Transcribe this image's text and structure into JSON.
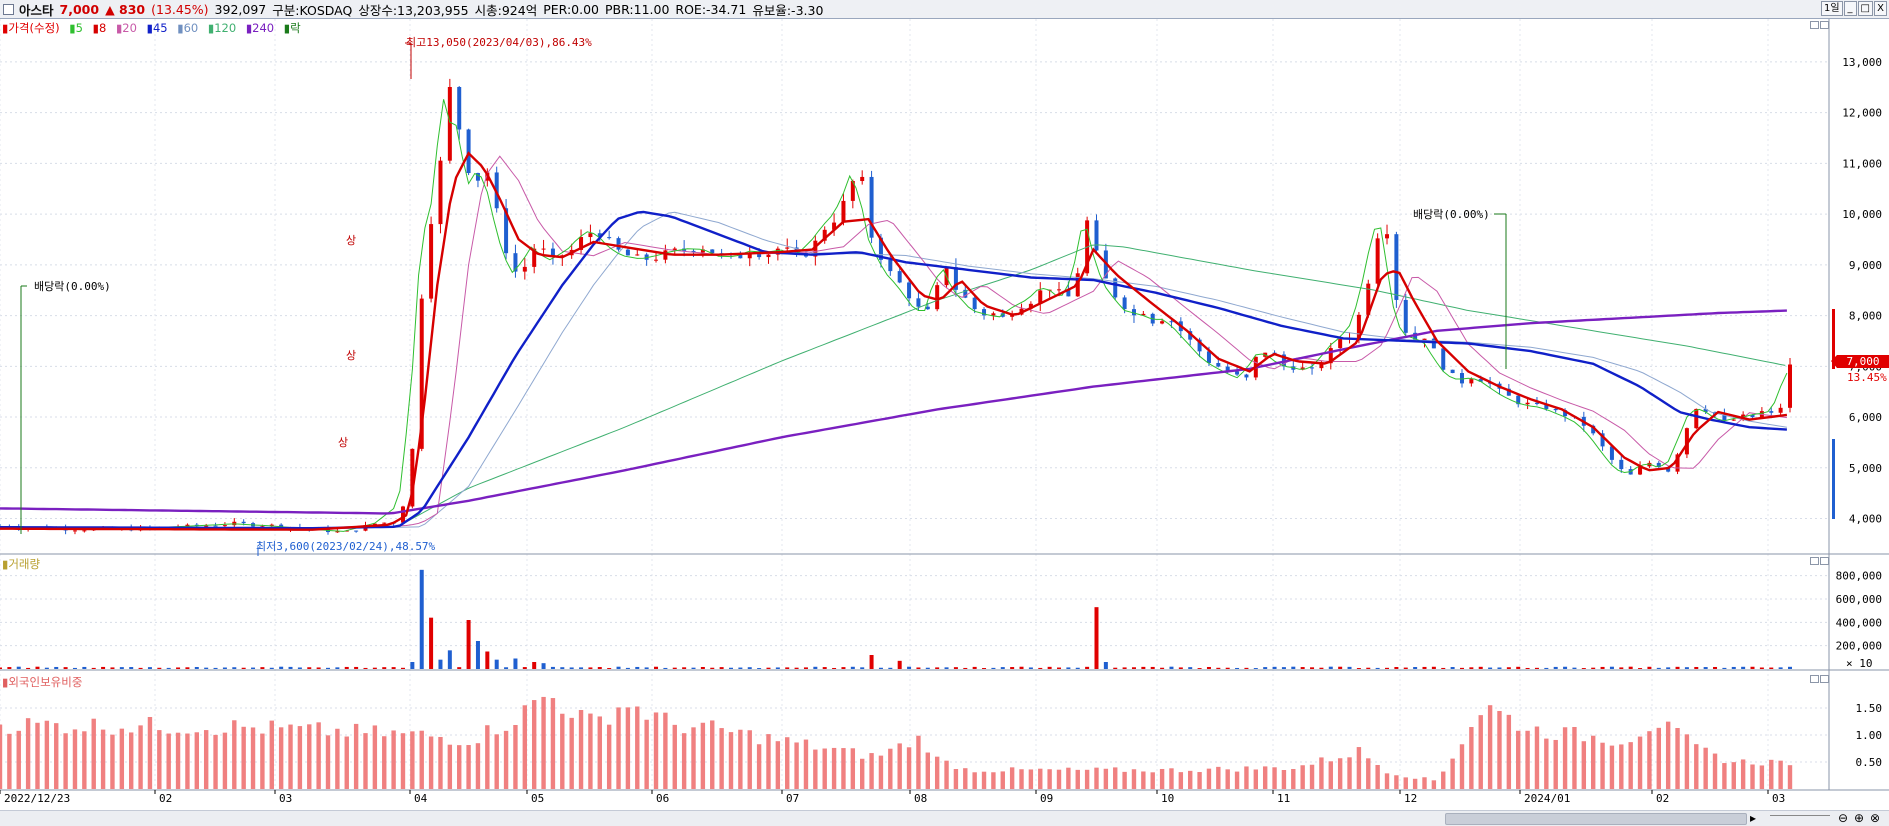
{
  "title_bar": {
    "stock_name": "아스타",
    "price": "7,000",
    "change": "▲ 830",
    "change_pct": "(13.45%)",
    "volume": "392,097",
    "market": "구분:KOSDAQ",
    "shares": "상장수:13,203,955",
    "market_cap": "시총:924억",
    "per": "PER:0.00",
    "pbr": "PBR:11.00",
    "roe": "ROE:-34.71",
    "float_ratio": "유보율:-3.30",
    "period_button": "1일",
    "minimize": "_",
    "maximize": "□",
    "close": "X"
  },
  "legend": {
    "price": "가격(수정)",
    "ma5": "5",
    "ma8": "8",
    "ma20": "20",
    "ma45": "45",
    "ma60": "60",
    "ma120": "120",
    "ma240": "240",
    "exdiv": "락"
  },
  "colors": {
    "up": "#e00000",
    "down": "#1f5fd0",
    "ma5": "#2fbf2f",
    "ma8": "#d60000",
    "ma20": "#c85aa8",
    "ma45": "#1020c8",
    "ma60": "#7090c0",
    "ma120": "#40b070",
    "ma240": "#7a20c0",
    "foreign": "#f08080"
  },
  "annotations": {
    "high": "최고13,050(2023/04/03),86.43%",
    "low": "최저3,600(2023/02/24),48.57%",
    "exdiv_left": "배당락(0.00%)",
    "exdiv_right": "배당락(0.00%)",
    "limit_up_1": "상",
    "limit_up_2": "상",
    "limit_up_3": "상"
  },
  "current_price_tag": {
    "price": "7,000",
    "pct": "13.45%"
  },
  "panes": {
    "volume_title": "거래량",
    "foreign_title": "외국인보유비중",
    "volume_multiplier": "× 10"
  },
  "chart_data": [
    {
      "type": "candlestick",
      "name": "price",
      "y_ticks": [
        "13,000",
        "12,000",
        "11,000",
        "10,000",
        "9,000",
        "8,000",
        "7,000",
        "6,000",
        "5,000",
        "4,000"
      ],
      "y_tick_values": [
        13000,
        12000,
        11000,
        10000,
        9000,
        8000,
        7000,
        6000,
        5000,
        4000
      ],
      "ylim": [
        3400,
        13450
      ],
      "x_ticks": [
        "2022/12/23",
        "02",
        "03",
        "04",
        "05",
        "06",
        "07",
        "08",
        "09",
        "10",
        "11",
        "12",
        "2024/01",
        "02",
        "03"
      ],
      "close_path": [
        [
          0,
          3850
        ],
        [
          40,
          3800
        ],
        [
          70,
          3780
        ],
        [
          100,
          3820
        ],
        [
          125,
          3850
        ],
        [
          150,
          3900
        ],
        [
          175,
          3860
        ],
        [
          200,
          3800
        ],
        [
          220,
          3720
        ],
        [
          240,
          3900
        ],
        [
          255,
          3950
        ],
        [
          263,
          4800
        ],
        [
          268,
          7600
        ],
        [
          272,
          9200
        ],
        [
          276,
          9900
        ],
        [
          280,
          10300
        ],
        [
          284,
          11700
        ],
        [
          288,
          12450
        ],
        [
          292,
          11600
        ],
        [
          296,
          11800
        ],
        [
          300,
          10900
        ],
        [
          304,
          10500
        ],
        [
          310,
          11100
        ],
        [
          316,
          10300
        ],
        [
          322,
          9500
        ],
        [
          328,
          8900
        ],
        [
          334,
          8800
        ],
        [
          340,
          9300
        ],
        [
          346,
          9400
        ],
        [
          352,
          9000
        ],
        [
          358,
          9200
        ],
        [
          364,
          9200
        ],
        [
          370,
          9450
        ],
        [
          376,
          9600
        ],
        [
          382,
          9700
        ],
        [
          388,
          9500
        ],
        [
          394,
          9300
        ],
        [
          400,
          9200
        ],
        [
          410,
          9100
        ],
        [
          420,
          9150
        ],
        [
          430,
          9250
        ],
        [
          440,
          9300
        ],
        [
          450,
          9350
        ],
        [
          460,
          9200
        ],
        [
          470,
          9100
        ],
        [
          480,
          9300
        ],
        [
          490,
          9200
        ],
        [
          500,
          9350
        ],
        [
          510,
          9150
        ],
        [
          520,
          9300
        ],
        [
          526,
          9700
        ],
        [
          532,
          9800
        ],
        [
          538,
          10100
        ],
        [
          544,
          10400
        ],
        [
          550,
          11100
        ],
        [
          556,
          9700
        ],
        [
          562,
          9300
        ],
        [
          568,
          8900
        ],
        [
          574,
          8700
        ],
        [
          580,
          8500
        ],
        [
          586,
          8200
        ],
        [
          592,
          8000
        ],
        [
          598,
          8200
        ],
        [
          604,
          9200
        ],
        [
          610,
          8600
        ],
        [
          616,
          8400
        ],
        [
          622,
          8200
        ],
        [
          628,
          8000
        ],
        [
          634,
          8100
        ],
        [
          640,
          7900
        ],
        [
          646,
          8050
        ],
        [
          652,
          8200
        ],
        [
          658,
          8250
        ],
        [
          664,
          8400
        ],
        [
          670,
          8600
        ],
        [
          676,
          8500
        ],
        [
          682,
          8300
        ],
        [
          688,
          8500
        ],
        [
          694,
          9600
        ],
        [
          698,
          10100
        ],
        [
          702,
          9200
        ],
        [
          708,
          8700
        ],
        [
          714,
          8400
        ],
        [
          720,
          8200
        ],
        [
          726,
          8000
        ],
        [
          732,
          8100
        ],
        [
          738,
          7900
        ],
        [
          744,
          7950
        ],
        [
          750,
          7900
        ],
        [
          756,
          7700
        ],
        [
          762,
          7500
        ],
        [
          768,
          7300
        ],
        [
          774,
          7100
        ],
        [
          780,
          7000
        ],
        [
          786,
          6900
        ],
        [
          792,
          6800
        ],
        [
          798,
          6750
        ],
        [
          804,
          7150
        ],
        [
          810,
          7300
        ],
        [
          816,
          7200
        ],
        [
          822,
          7000
        ],
        [
          828,
          7000
        ],
        [
          834,
          6950
        ],
        [
          840,
          6900
        ],
        [
          846,
          7100
        ],
        [
          852,
          7300
        ],
        [
          858,
          7550
        ],
        [
          864,
          7600
        ],
        [
          870,
          8000
        ],
        [
          876,
          8700
        ],
        [
          880,
          9400
        ],
        [
          884,
          9800
        ],
        [
          888,
          9700
        ],
        [
          892,
          8700
        ],
        [
          896,
          8000
        ],
        [
          900,
          7700
        ],
        [
          906,
          7500
        ],
        [
          912,
          7600
        ],
        [
          918,
          7300
        ],
        [
          924,
          7000
        ],
        [
          930,
          6800
        ],
        [
          936,
          6700
        ],
        [
          942,
          6800
        ],
        [
          948,
          6750
        ],
        [
          954,
          6650
        ],
        [
          960,
          6500
        ],
        [
          966,
          6400
        ],
        [
          972,
          6300
        ],
        [
          978,
          6250
        ],
        [
          984,
          6200
        ],
        [
          990,
          6200
        ],
        [
          996,
          6100
        ],
        [
          1002,
          6050
        ],
        [
          1008,
          5950
        ],
        [
          1014,
          5850
        ],
        [
          1020,
          5650
        ],
        [
          1026,
          5400
        ],
        [
          1032,
          5150
        ],
        [
          1038,
          4950
        ],
        [
          1044,
          4850
        ],
        [
          1050,
          5000
        ],
        [
          1056,
          5100
        ],
        [
          1062,
          5050
        ],
        [
          1068,
          4950
        ],
        [
          1074,
          5300
        ],
        [
          1080,
          5800
        ],
        [
          1086,
          6200
        ],
        [
          1092,
          6150
        ],
        [
          1098,
          6050
        ],
        [
          1104,
          5900
        ],
        [
          1110,
          5950
        ],
        [
          1116,
          6000
        ],
        [
          1122,
          6000
        ],
        [
          1128,
          6100
        ],
        [
          1134,
          6050
        ],
        [
          1140,
          6200
        ],
        [
          1146,
          7000
        ]
      ],
      "ma8_path": [
        [
          0,
          3800
        ],
        [
          100,
          3790
        ],
        [
          200,
          3780
        ],
        [
          250,
          3880
        ],
        [
          262,
          4100
        ],
        [
          270,
          5800
        ],
        [
          280,
          8600
        ],
        [
          290,
          10600
        ],
        [
          300,
          11200
        ],
        [
          310,
          10900
        ],
        [
          320,
          10300
        ],
        [
          332,
          9500
        ],
        [
          345,
          9200
        ],
        [
          360,
          9150
        ],
        [
          380,
          9450
        ],
        [
          400,
          9350
        ],
        [
          430,
          9200
        ],
        [
          460,
          9200
        ],
        [
          500,
          9250
        ],
        [
          520,
          9300
        ],
        [
          540,
          9850
        ],
        [
          556,
          9900
        ],
        [
          570,
          9200
        ],
        [
          590,
          8400
        ],
        [
          602,
          8300
        ],
        [
          615,
          8700
        ],
        [
          630,
          8200
        ],
        [
          650,
          8000
        ],
        [
          670,
          8300
        ],
        [
          690,
          8600
        ],
        [
          700,
          9300
        ],
        [
          715,
          8800
        ],
        [
          735,
          8300
        ],
        [
          760,
          7700
        ],
        [
          780,
          7150
        ],
        [
          800,
          6900
        ],
        [
          815,
          7250
        ],
        [
          830,
          7100
        ],
        [
          850,
          7050
        ],
        [
          870,
          7500
        ],
        [
          885,
          8800
        ],
        [
          895,
          8900
        ],
        [
          905,
          8300
        ],
        [
          920,
          7500
        ],
        [
          940,
          6900
        ],
        [
          960,
          6600
        ],
        [
          980,
          6350
        ],
        [
          1000,
          6150
        ],
        [
          1020,
          5800
        ],
        [
          1040,
          5200
        ],
        [
          1055,
          4950
        ],
        [
          1070,
          5000
        ],
        [
          1085,
          5700
        ],
        [
          1100,
          6100
        ],
        [
          1120,
          5950
        ],
        [
          1146,
          6050
        ]
      ],
      "ma45_path": [
        [
          0,
          3830
        ],
        [
          200,
          3810
        ],
        [
          255,
          3840
        ],
        [
          270,
          4150
        ],
        [
          300,
          5600
        ],
        [
          330,
          7200
        ],
        [
          360,
          8600
        ],
        [
          380,
          9400
        ],
        [
          395,
          9900
        ],
        [
          410,
          10050
        ],
        [
          430,
          9950
        ],
        [
          460,
          9600
        ],
        [
          490,
          9250
        ],
        [
          520,
          9200
        ],
        [
          550,
          9250
        ],
        [
          580,
          9050
        ],
        [
          620,
          8900
        ],
        [
          660,
          8750
        ],
        [
          700,
          8700
        ],
        [
          740,
          8450
        ],
        [
          780,
          8150
        ],
        [
          820,
          7800
        ],
        [
          860,
          7550
        ],
        [
          900,
          7500
        ],
        [
          940,
          7450
        ],
        [
          980,
          7300
        ],
        [
          1020,
          7050
        ],
        [
          1050,
          6600
        ],
        [
          1075,
          6100
        ],
        [
          1095,
          5950
        ],
        [
          1120,
          5800
        ],
        [
          1146,
          5750
        ]
      ],
      "ma240_path": [
        [
          0,
          4200
        ],
        [
          250,
          4100
        ],
        [
          300,
          4350
        ],
        [
          400,
          4950
        ],
        [
          500,
          5600
        ],
        [
          600,
          6150
        ],
        [
          700,
          6600
        ],
        [
          800,
          6950
        ],
        [
          870,
          7400
        ],
        [
          920,
          7700
        ],
        [
          980,
          7850
        ],
        [
          1040,
          7950
        ],
        [
          1100,
          8050
        ],
        [
          1146,
          8100
        ]
      ],
      "ma120_path": [
        [
          255,
          3850
        ],
        [
          300,
          4600
        ],
        [
          400,
          5800
        ],
        [
          500,
          7100
        ],
        [
          600,
          8300
        ],
        [
          660,
          8900
        ],
        [
          700,
          9400
        ],
        [
          720,
          9350
        ],
        [
          800,
          8900
        ],
        [
          880,
          8500
        ],
        [
          940,
          8100
        ],
        [
          1020,
          7700
        ],
        [
          1080,
          7400
        ],
        [
          1146,
          7000
        ]
      ]
    },
    {
      "type": "bar",
      "name": "volume",
      "y_ticks": [
        "800,000",
        "600,000",
        "400,000",
        "200,000"
      ],
      "y_tick_values": [
        800000,
        600000,
        400000,
        200000
      ],
      "ylim": [
        0,
        900000
      ],
      "spikes": [
        [
          262,
          60000
        ],
        [
          268,
          180000
        ],
        [
          272,
          850000
        ],
        [
          276,
          440000
        ],
        [
          280,
          120000
        ],
        [
          284,
          80000
        ],
        [
          290,
          160000
        ],
        [
          300,
          420000
        ],
        [
          304,
          240000
        ],
        [
          310,
          150000
        ],
        [
          320,
          80000
        ],
        [
          330,
          90000
        ],
        [
          340,
          60000
        ],
        [
          350,
          50000
        ],
        [
          560,
          120000
        ],
        [
          575,
          70000
        ],
        [
          704,
          530000
        ],
        [
          708,
          60000
        ]
      ]
    },
    {
      "type": "bar",
      "name": "foreign_ownership",
      "y_ticks": [
        "1.50",
        "1.00",
        "0.50"
      ],
      "y_tick_values": [
        1.5,
        1.0,
        0.5
      ],
      "ylim": [
        0,
        2.0
      ]
    }
  ]
}
